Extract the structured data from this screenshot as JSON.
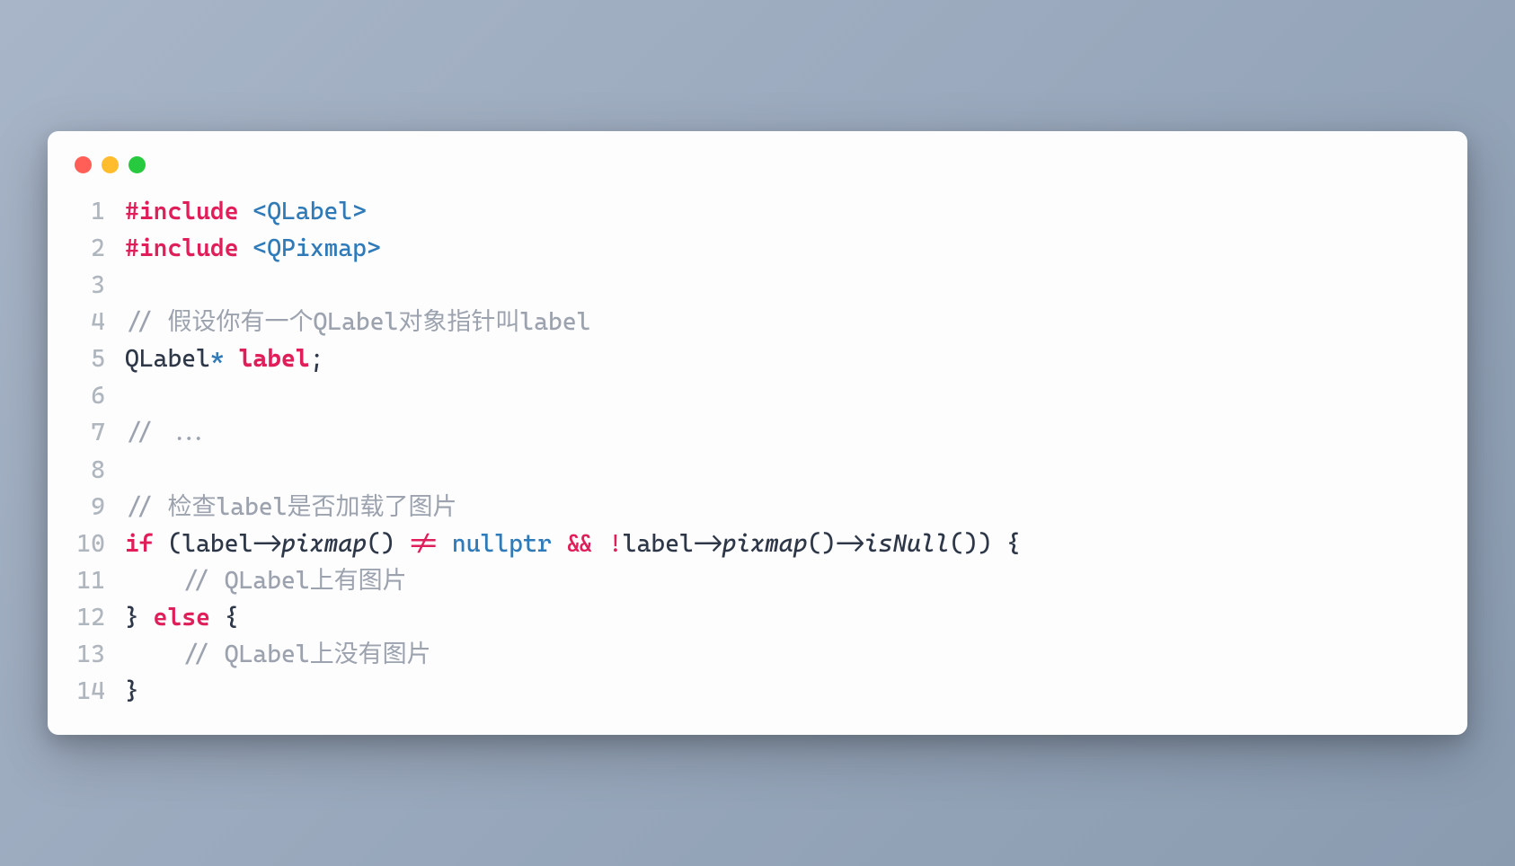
{
  "titlebar": {
    "dots": [
      "red",
      "yellow",
      "green"
    ]
  },
  "code": {
    "lines": [
      {
        "num": "1",
        "tokens": [
          {
            "cls": "tok-preproc-hash",
            "t": "#"
          },
          {
            "cls": "tok-preproc-kw",
            "t": "include"
          },
          {
            "cls": "",
            "t": " "
          },
          {
            "cls": "tok-angle",
            "t": "<QLabel>"
          }
        ]
      },
      {
        "num": "2",
        "tokens": [
          {
            "cls": "tok-preproc-hash",
            "t": "#"
          },
          {
            "cls": "tok-preproc-kw",
            "t": "include"
          },
          {
            "cls": "",
            "t": " "
          },
          {
            "cls": "tok-angle",
            "t": "<QPixmap>"
          }
        ]
      },
      {
        "num": "3",
        "tokens": [
          {
            "cls": "",
            "t": ""
          }
        ]
      },
      {
        "num": "4",
        "tokens": [
          {
            "cls": "tok-comment",
            "t": "// 假设你有一个QLabel对象指针叫label"
          }
        ]
      },
      {
        "num": "5",
        "tokens": [
          {
            "cls": "tok-type",
            "t": "QLabel"
          },
          {
            "cls": "tok-op-star",
            "t": "*"
          },
          {
            "cls": "",
            "t": " "
          },
          {
            "cls": "tok-ident-decl",
            "t": "label"
          },
          {
            "cls": "tok-punct",
            "t": ";"
          }
        ]
      },
      {
        "num": "6",
        "tokens": [
          {
            "cls": "",
            "t": ""
          }
        ]
      },
      {
        "num": "7",
        "tokens": [
          {
            "cls": "tok-comment",
            "t": "// ..."
          }
        ]
      },
      {
        "num": "8",
        "tokens": [
          {
            "cls": "",
            "t": ""
          }
        ]
      },
      {
        "num": "9",
        "tokens": [
          {
            "cls": "tok-comment",
            "t": "// 检查label是否加载了图片"
          }
        ]
      },
      {
        "num": "10",
        "tokens": [
          {
            "cls": "tok-kw",
            "t": "if"
          },
          {
            "cls": "tok-punct",
            "t": " (label->"
          },
          {
            "cls": "tok-func",
            "t": "pixmap"
          },
          {
            "cls": "tok-punct",
            "t": "() "
          },
          {
            "cls": "tok-op-red",
            "t": "!="
          },
          {
            "cls": "",
            "t": " "
          },
          {
            "cls": "tok-null",
            "t": "nullptr"
          },
          {
            "cls": "",
            "t": " "
          },
          {
            "cls": "tok-op-amp",
            "t": "&&"
          },
          {
            "cls": "",
            "t": " "
          },
          {
            "cls": "tok-op-red",
            "t": "!"
          },
          {
            "cls": "tok-punct",
            "t": "label->"
          },
          {
            "cls": "tok-func",
            "t": "pixmap"
          },
          {
            "cls": "tok-punct",
            "t": "()->"
          },
          {
            "cls": "tok-func",
            "t": "isNull"
          },
          {
            "cls": "tok-punct",
            "t": "()) {"
          }
        ]
      },
      {
        "num": "11",
        "tokens": [
          {
            "cls": "",
            "t": "    "
          },
          {
            "cls": "tok-comment",
            "t": "// QLabel上有图片"
          }
        ]
      },
      {
        "num": "12",
        "tokens": [
          {
            "cls": "tok-punct",
            "t": "} "
          },
          {
            "cls": "tok-kw",
            "t": "else"
          },
          {
            "cls": "tok-punct",
            "t": " {"
          }
        ]
      },
      {
        "num": "13",
        "tokens": [
          {
            "cls": "",
            "t": "    "
          },
          {
            "cls": "tok-comment",
            "t": "// QLabel上没有图片"
          }
        ]
      },
      {
        "num": "14",
        "tokens": [
          {
            "cls": "tok-punct",
            "t": "}"
          }
        ]
      }
    ]
  }
}
